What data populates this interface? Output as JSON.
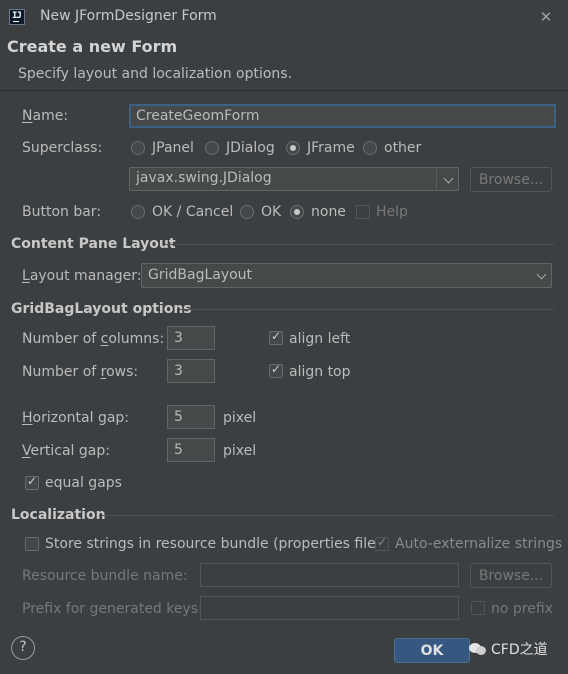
{
  "window": {
    "title": "New JFormDesigner Form",
    "icon": "intellij-idea-icon"
  },
  "header": {
    "title": "Create a new Form",
    "subtitle": "Specify layout and localization options."
  },
  "form": {
    "name_label": "Name:",
    "name_value": "CreateGeomForm",
    "superclass_label": "Superclass:",
    "superclass_options": [
      "JPanel",
      "JDialog",
      "JFrame",
      "other"
    ],
    "superclass_selected": "JFrame",
    "superclass_field_value": "javax.swing.JDialog",
    "browse_label": "Browse...",
    "buttonbar_label": "Button bar:",
    "buttonbar_options": [
      "OK / Cancel",
      "OK",
      "none"
    ],
    "buttonbar_selected": "none",
    "help_label": "Help",
    "help_checked": false
  },
  "content_pane": {
    "section_title": "Content Pane Layout",
    "layout_manager_label": "Layout manager:",
    "layout_manager_value": "GridBagLayout"
  },
  "gridbag": {
    "section_title": "GridBagLayout options",
    "columns_label": "Number of columns:",
    "columns_value": "3",
    "rows_label": "Number of rows:",
    "rows_value": "3",
    "align_left_label": "align left",
    "align_left_checked": true,
    "align_top_label": "align top",
    "align_top_checked": true,
    "hgap_label": "Horizontal gap:",
    "hgap_value": "5",
    "vgap_label": "Vertical gap:",
    "vgap_value": "5",
    "pixel_unit": "pixel",
    "equal_gaps_label": "equal gaps",
    "equal_gaps_checked": true
  },
  "localization": {
    "section_title": "Localization",
    "store_strings_label": "Store strings in resource bundle (properties file)",
    "store_strings_checked": false,
    "auto_externalize_label": "Auto-externalize strings",
    "auto_externalize_checked": true,
    "bundle_name_label": "Resource bundle name:",
    "bundle_name_value": "",
    "browse_label": "Browse...",
    "prefix_label": "Prefix for generated keys:",
    "prefix_value": "",
    "no_prefix_label": "no prefix",
    "no_prefix_checked": false
  },
  "footer": {
    "help_glyph": "?",
    "ok_label": "OK",
    "watermark_text": "CFD之道"
  },
  "colors": {
    "background": "#3c3f41",
    "field": "#45494a",
    "primary": "#365880",
    "focus": "#3d6185",
    "text": "#bbbbbb"
  }
}
